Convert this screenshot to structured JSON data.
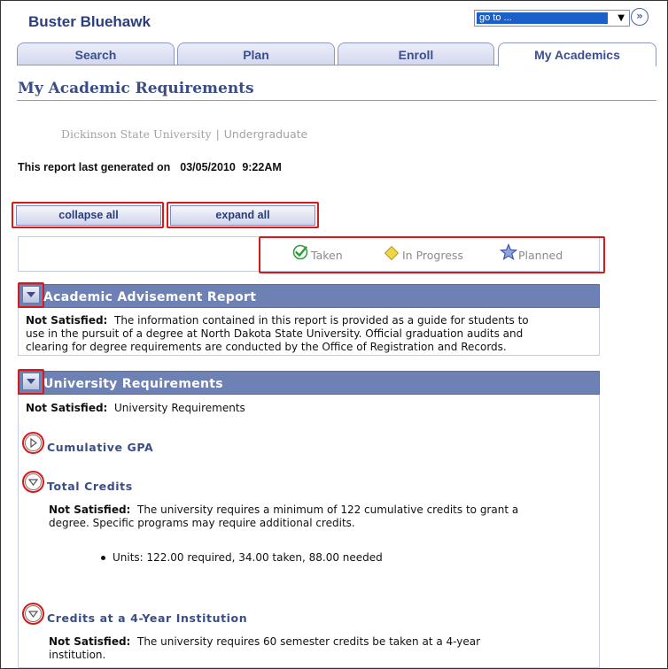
{
  "header": {
    "user_name": "Buster Bluehawk",
    "goto_value": "go to ...",
    "go_button": "»"
  },
  "tabs": [
    {
      "label": "Search"
    },
    {
      "label": "Plan"
    },
    {
      "label": "Enroll"
    },
    {
      "label": "My Academics",
      "active": true
    }
  ],
  "page": {
    "title": "My Academic Requirements",
    "institution": "Dickinson State University",
    "separator": "|",
    "career": "Undergraduate",
    "report_label": "This report last generated on",
    "report_date": "03/05/2010",
    "report_time": "9:22AM"
  },
  "buttons": {
    "collapse_all": "collapse all",
    "expand_all": "expand all"
  },
  "legend": {
    "taken": "Taken",
    "in_progress": "In Progress",
    "planned": "Planned"
  },
  "sections": [
    {
      "title": "Academic Advisement Report",
      "status_label": "Not Satisfied:",
      "lines": [
        "The information contained in this report is provided as a guide for students to",
        "use in the pursuit of a degree at North Dakota State University. Official graduation audits and",
        "clearing for degree requirements are conducted by the Office of Registration and Records."
      ]
    },
    {
      "title": "University Requirements",
      "status_label": "Not Satisfied:",
      "status_text": "University Requirements",
      "requirements": [
        {
          "title": "Cumulative GPA",
          "collapsed": true
        },
        {
          "title": "Total Credits",
          "status_label": "Not Satisfied:",
          "lines": [
            "The university requires a minimum of 122 cumulative credits to grant a",
            "degree. Specific programs may require additional credits."
          ],
          "units": "Units: 122.00 required, 34.00 taken, 88.00 needed"
        },
        {
          "title": "Credits at a 4-Year Institution",
          "status_label": "Not Satisfied:",
          "lines": [
            "The university requires 60 semester credits be taken at a 4-year",
            "institution."
          ]
        }
      ]
    }
  ],
  "colors": {
    "accent": "#3b4d86",
    "section_header": "#6e81b4",
    "highlight": "#d81919",
    "taken": "#2e9b3a",
    "in_progress": "#e8c531",
    "planned": "#4866b3"
  },
  "icons": [
    "go-icon",
    "checkmark-icon",
    "diamond-icon",
    "star-icon",
    "collapse-triangle-icon",
    "expand-triangle-icon"
  ]
}
